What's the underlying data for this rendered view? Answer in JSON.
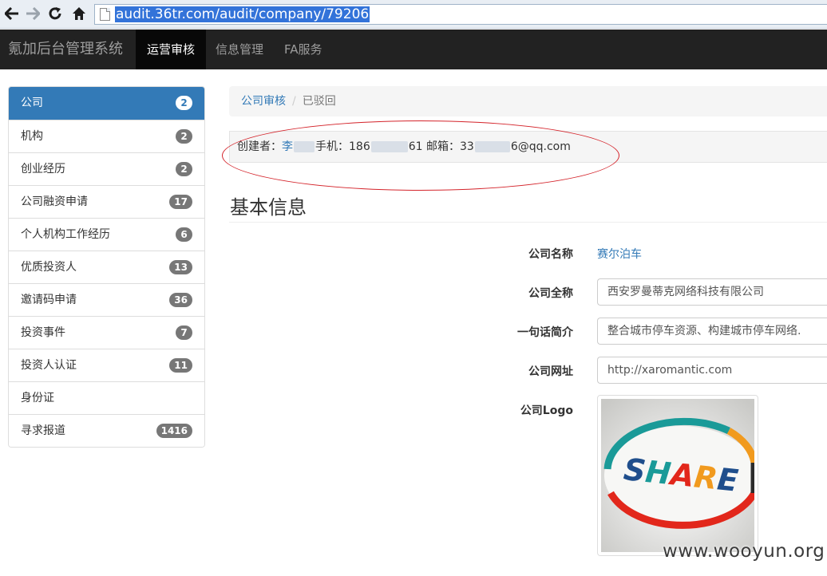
{
  "browser": {
    "back_icon": "arrow-left-icon",
    "forward_icon": "arrow-right-icon",
    "reload_icon": "reload-icon",
    "home_icon": "home-icon",
    "url": "audit.36tr.com/audit/company/79206"
  },
  "navbar": {
    "brand": "氪加后台管理系统",
    "items": [
      {
        "label": "运营审核",
        "active": true
      },
      {
        "label": "信息管理",
        "active": false
      },
      {
        "label": "FA服务",
        "active": false
      }
    ]
  },
  "sidebar": {
    "items": [
      {
        "label": "公司",
        "badge": "2",
        "active": true
      },
      {
        "label": "机构",
        "badge": "2"
      },
      {
        "label": "创业经历",
        "badge": "2"
      },
      {
        "label": "公司融资申请",
        "badge": "17"
      },
      {
        "label": "个人机构工作经历",
        "badge": "6"
      },
      {
        "label": "优质投资人",
        "badge": "13"
      },
      {
        "label": "邀请码申请",
        "badge": "36"
      },
      {
        "label": "投资事件",
        "badge": "7"
      },
      {
        "label": "投资人认证",
        "badge": "11"
      },
      {
        "label": "身份证",
        "badge": ""
      },
      {
        "label": "寻求报道",
        "badge": "1416"
      }
    ]
  },
  "breadcrumb": {
    "link": "公司审核",
    "separator": "/",
    "current": "已驳回"
  },
  "creator": {
    "creator_label": "创建者：",
    "creator_name": "李",
    "phone_label": "手机：",
    "phone_prefix": "186",
    "phone_suffix": "61",
    "email_label": "邮箱：",
    "email_prefix": "33",
    "email_suffix": "6@qq.com"
  },
  "section_title": "基本信息",
  "form": {
    "name_label": "公司名称",
    "name_value": "赛尔泊车",
    "fullname_label": "公司全称",
    "fullname_value": "西安罗曼蒂克网络科技有限公司",
    "intro_label": "一句话简介",
    "intro_value": "整合城市停车资源、构建城市停车网络.",
    "website_label": "公司网址",
    "website_value": "http://xaromantic.com",
    "logo_label": "公司Logo",
    "logo_text": "SHARE"
  },
  "watermark": "www.wooyun.org",
  "colors": {
    "primary": "#337ab7",
    "navbar_bg": "#222222",
    "annotation_red": "#d4242b"
  }
}
